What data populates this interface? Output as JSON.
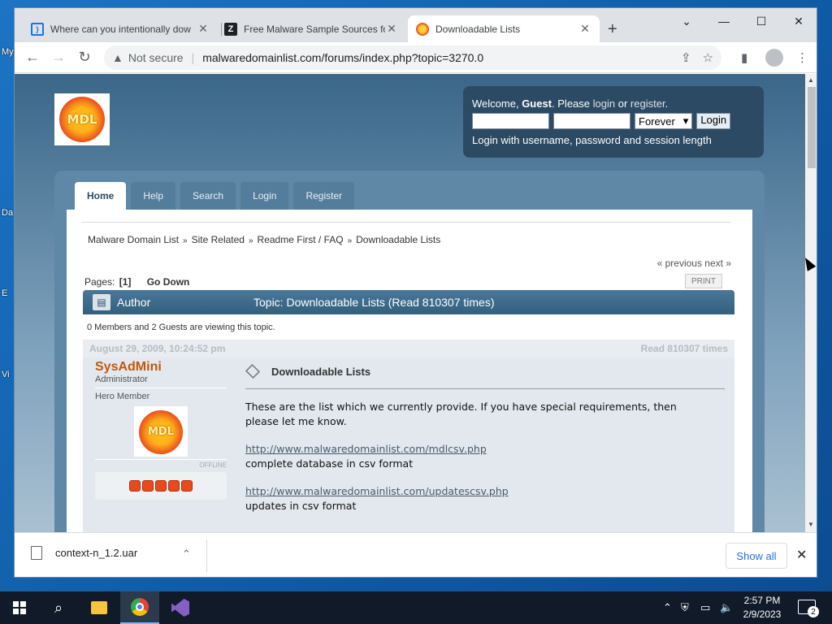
{
  "desktop": {
    "labels": [
      "My",
      "Da",
      "E",
      "Vi"
    ]
  },
  "browser": {
    "tabs": [
      {
        "title": "Where can you intentionally dow",
        "active": false
      },
      {
        "title": "Free Malware Sample Sources fo",
        "active": false
      },
      {
        "title": "Downloadable Lists",
        "active": true
      }
    ],
    "not_secure": "Not secure",
    "url": "malwaredomainlist.com/forums/index.php?topic=3270.0"
  },
  "site": {
    "logo_text": "MDL",
    "userbox": {
      "welcome": "Welcome,",
      "guest": "Guest",
      "please": ". Please",
      "login_link": "login",
      "or": "or",
      "register_link": "register",
      "period": ".",
      "session_option": "Forever",
      "login_button": "Login",
      "hint": "Login with username, password and session length"
    },
    "menu": [
      "Home",
      "Help",
      "Search",
      "Login",
      "Register"
    ],
    "breadcrumb": [
      "Malware Domain List",
      "Site Related",
      "Readme First / FAQ",
      "Downloadable Lists"
    ],
    "breadcrumb_sep": "»",
    "prevnext": "« previous next »",
    "pages_label": "Pages:",
    "current_page": "[1]",
    "go_down": "Go Down",
    "print": "PRINT",
    "catbar": {
      "author": "Author",
      "topic": "Topic: Downloadable Lists  (Read 810307 times)"
    },
    "viewing": "0 Members and 2 Guests are viewing this topic.",
    "post": {
      "date": "August 29, 2009, 10:24:52 pm",
      "reads": "Read 810307 times",
      "poster_name": "SysAdMini",
      "poster_role": "Administrator",
      "poster_title": "Hero Member",
      "status": "OFFLINE",
      "subject": "Downloadable Lists",
      "intro_line1": "These are the list which we currently provide. If you have special requirements, then",
      "intro_line2": "please let me know.",
      "link1": "http://www.malwaredomainlist.com/mdlcsv.php",
      "desc1": "complete database in csv format",
      "link2": "http://www.malwaredomainlist.com/updatescsv.php",
      "desc2": "updates in csv format"
    }
  },
  "download_bar": {
    "filename": "context-n_1.2.uar",
    "show_all": "Show all"
  },
  "taskbar": {
    "time": "2:57 PM",
    "date": "2/9/2023",
    "notification_count": "2"
  }
}
